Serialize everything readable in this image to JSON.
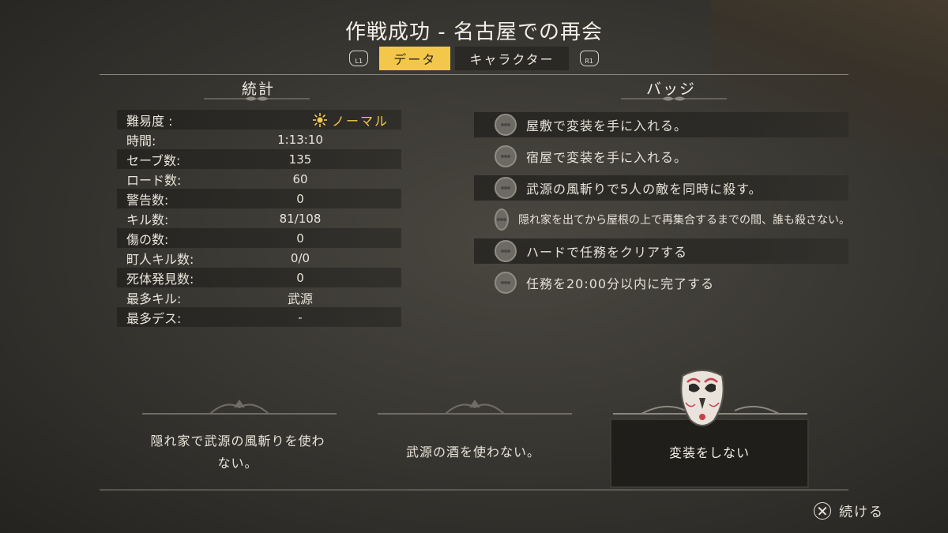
{
  "title": "作戦成功 - 名古屋での再会",
  "tabs": {
    "left_shoulder": "L1",
    "right_shoulder": "R1",
    "items": [
      {
        "label": "データ",
        "active": true
      },
      {
        "label": "キャラクター",
        "active": false
      }
    ]
  },
  "stats": {
    "heading": "統計",
    "difficulty_label": "難易度 :",
    "difficulty_value": "ノーマル",
    "rows": [
      {
        "label": "時間:",
        "value": "1:13:10"
      },
      {
        "label": "セーブ数:",
        "value": "135"
      },
      {
        "label": "ロード数:",
        "value": "60"
      },
      {
        "label": "警告数:",
        "value": "0"
      },
      {
        "label": "キル数:",
        "value": "81/108"
      },
      {
        "label": "傷の数:",
        "value": "0"
      },
      {
        "label": "町人キル数:",
        "value": "0/0"
      },
      {
        "label": "死体発見数:",
        "value": "0"
      },
      {
        "label": "最多キル:",
        "value": "武源"
      },
      {
        "label": "最多デス:",
        "value": "-"
      }
    ]
  },
  "badges": {
    "heading": "バッジ",
    "items": [
      "屋敷で変装を手に入れる。",
      "宿屋で変装を手に入れる。",
      "武源の風斬りで5人の敵を同時に殺す。",
      "隠れ家を出てから屋根の上で再集合するまでの間、誰も殺さない。",
      "ハードで任務をクリアする",
      "任務を20:00分以内に完了する"
    ]
  },
  "challenges": [
    {
      "text": "隠れ家で武源の風斬りを使わない。",
      "selected": false
    },
    {
      "text": "武源の酒を使わない。",
      "selected": false
    },
    {
      "text": "変装をしない",
      "selected": true
    }
  ],
  "continue_label": "続ける",
  "colors": {
    "accent": "#f3c84a",
    "background": "#3a3833",
    "text": "#e8e4da"
  }
}
